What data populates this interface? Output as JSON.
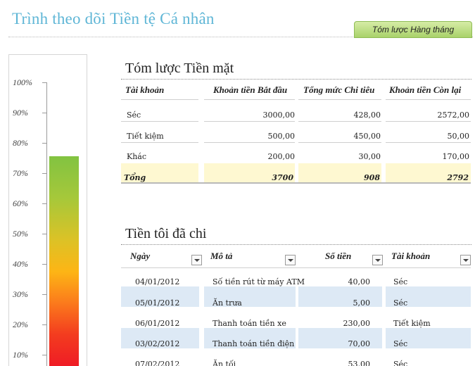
{
  "header": {
    "title": "Trình theo dõi Tiền tệ Cá nhân",
    "summary_button": "Tóm lược Hàng tháng"
  },
  "gauge": {
    "ticks": [
      "100%",
      "90%",
      "80%",
      "70%",
      "60%",
      "50%",
      "40%",
      "30%",
      "20%",
      "10%"
    ],
    "level_percent": 75.5,
    "colors": [
      "#82c341",
      "#fdb515",
      "#ef1c25"
    ]
  },
  "cash_summary": {
    "title": "Tóm lược Tiền mặt",
    "headers": [
      "Tài khoản",
      "Khoản tiền Bắt đầu",
      "Tổng mức Chi tiêu",
      "Khoản tiền Còn lại"
    ],
    "rows": [
      {
        "account": "Séc",
        "start": "3000,00",
        "spent": "428,00",
        "remaining": "2572,00"
      },
      {
        "account": "Tiết kiệm",
        "start": "500,00",
        "spent": "450,00",
        "remaining": "50,00"
      },
      {
        "account": "Khác",
        "start": "200,00",
        "spent": "30,00",
        "remaining": "170,00"
      }
    ],
    "total": {
      "label": "Tổng",
      "start": "3700",
      "spent": "908",
      "remaining": "2792"
    }
  },
  "spending": {
    "title": "Tiền tôi đã chi",
    "headers": [
      "Ngày",
      "Mô tả",
      "Số tiền",
      "Tài khoản"
    ],
    "rows": [
      {
        "date": "04/01/2012",
        "desc": "Số tiền rút từ máy ATM",
        "amount": "40,00",
        "account": "Séc"
      },
      {
        "date": "05/01/2012",
        "desc": "Ăn trưa",
        "amount": "5,00",
        "account": "Séc"
      },
      {
        "date": "06/01/2012",
        "desc": "Thanh toán tiền xe",
        "amount": "230,00",
        "account": "Tiết kiệm"
      },
      {
        "date": "03/02/2012",
        "desc": "Thanh toán tiền điện",
        "amount": "70,00",
        "account": "Séc"
      },
      {
        "date": "07/02/2012",
        "desc": "Ăn tối",
        "amount": "53,00",
        "account": "Séc"
      }
    ]
  }
}
